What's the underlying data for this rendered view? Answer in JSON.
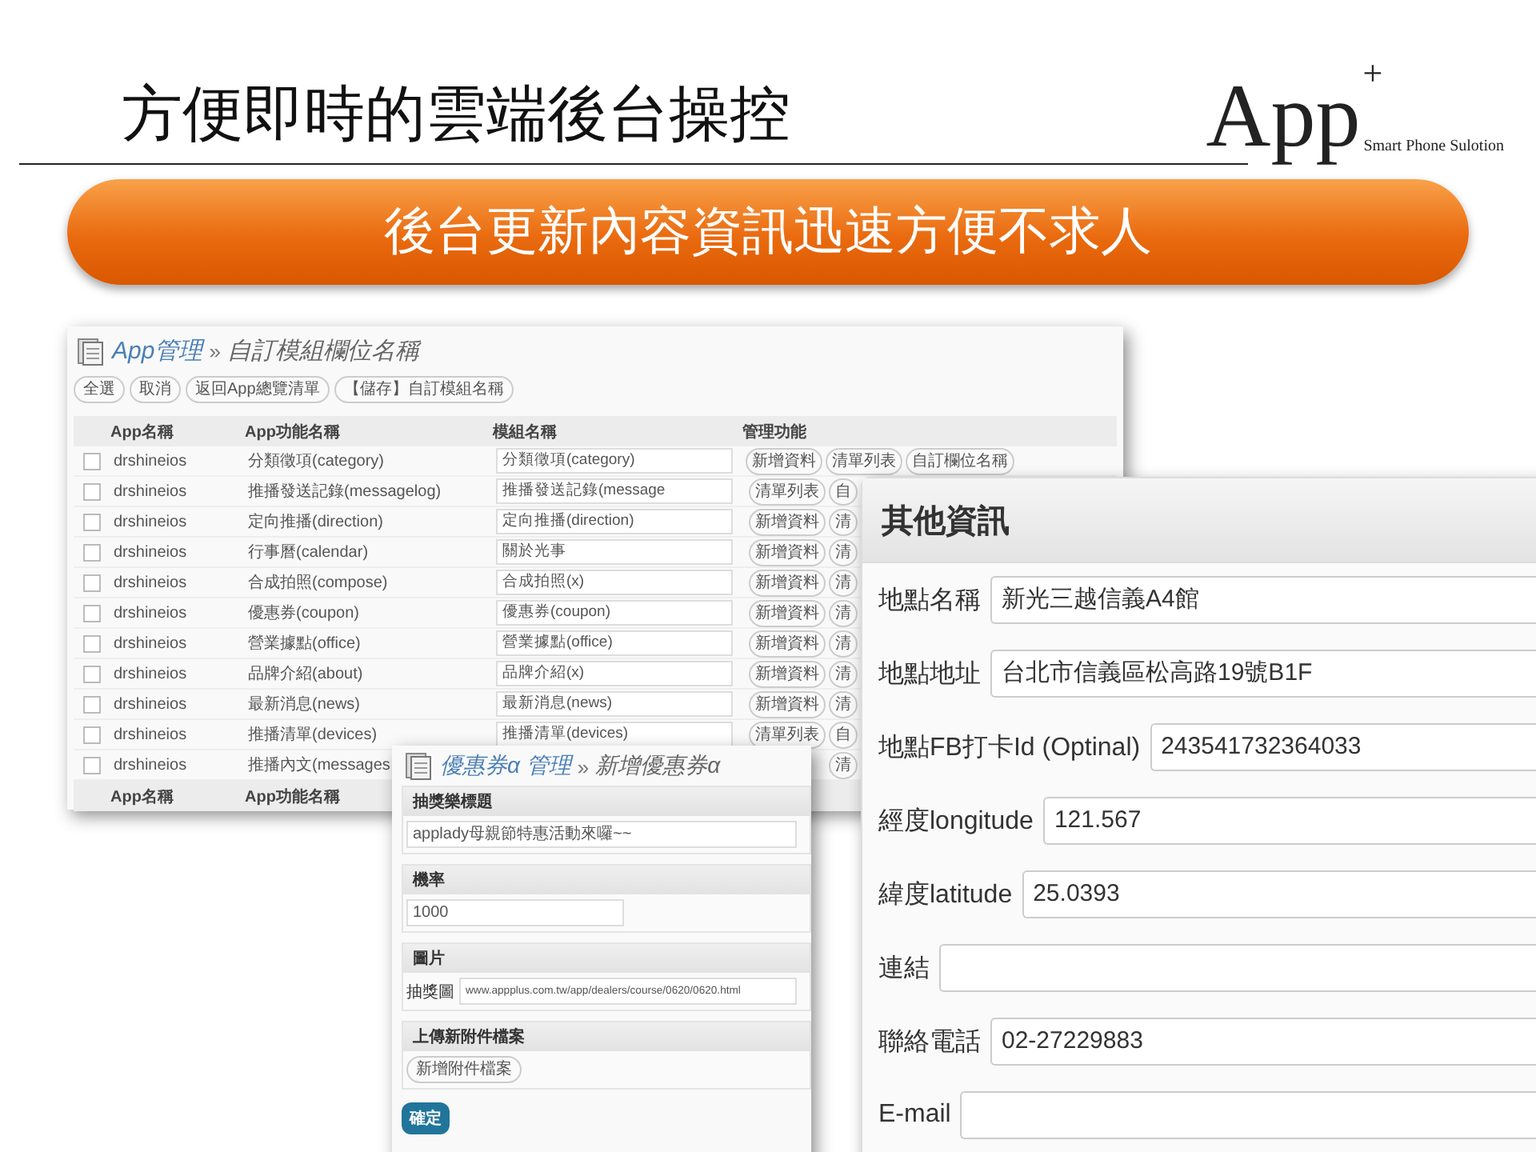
{
  "slide": {
    "title": "方便即時的雲端後台操控",
    "logo": {
      "name": "App",
      "superscript": "+",
      "tagline": "Smart Phone Sulotion"
    },
    "banner": "後台更新內容資訊迅速方便不求人"
  },
  "module_window": {
    "breadcrumb_link": "App管理",
    "breadcrumb_separator": "»",
    "breadcrumb_current": "自訂模組欄位名稱",
    "buttons": [
      "全選",
      "取消",
      "返回App總覽清單",
      "【儲存】自訂模組名稱"
    ],
    "columns": [
      "App名稱",
      "App功能名稱",
      "模組名稱",
      "管理功能"
    ],
    "rows": [
      {
        "checked": false,
        "app": "drshineios",
        "feature": "分類徵項(category)",
        "module": "分類徵項(category)",
        "actions": [
          "新增資料",
          "清單列表",
          "自訂欄位名稱"
        ]
      },
      {
        "checked": false,
        "app": "drshineios",
        "feature": "推播發送記錄(messagelog)",
        "module": "推播發送記錄(message",
        "actions": [
          "清單列表",
          "自"
        ]
      },
      {
        "checked": false,
        "app": "drshineios",
        "feature": "定向推播(direction)",
        "module": "定向推播(direction)",
        "actions": [
          "新增資料",
          "清"
        ]
      },
      {
        "checked": false,
        "app": "drshineios",
        "feature": "行事曆(calendar)",
        "module": "關於光事",
        "actions": [
          "新增資料",
          "清"
        ]
      },
      {
        "checked": false,
        "app": "drshineios",
        "feature": "合成拍照(compose)",
        "module": "合成拍照(x)",
        "actions": [
          "新增資料",
          "清"
        ]
      },
      {
        "checked": false,
        "app": "drshineios",
        "feature": "優惠券(coupon)",
        "module": "優惠券(coupon)",
        "actions": [
          "新增資料",
          "清"
        ]
      },
      {
        "checked": false,
        "app": "drshineios",
        "feature": "營業據點(office)",
        "module": "營業據點(office)",
        "actions": [
          "新增資料",
          "清"
        ]
      },
      {
        "checked": false,
        "app": "drshineios",
        "feature": "品牌介紹(about)",
        "module": "品牌介紹(x)",
        "actions": [
          "新增資料",
          "清"
        ]
      },
      {
        "checked": false,
        "app": "drshineios",
        "feature": "最新消息(news)",
        "module": "最新消息(news)",
        "actions": [
          "新增資料",
          "清"
        ]
      },
      {
        "checked": false,
        "app": "drshineios",
        "feature": "推播清單(devices)",
        "module": "推播清單(devices)",
        "actions": [
          "清單列表",
          "自"
        ]
      },
      {
        "checked": false,
        "app": "drshineios",
        "feature": "推播內文(messages",
        "actions": [
          "清"
        ]
      }
    ],
    "footer": [
      "App名稱",
      "App功能名稱"
    ]
  },
  "coupon_window": {
    "breadcrumb_link": "優惠券α 管理",
    "breadcrumb_separator": "»",
    "breadcrumb_current": "新增優惠券α",
    "sections": [
      {
        "kind": "text",
        "heading": "抽獎樂標題",
        "value": "applady母親節特惠活動來囉~~"
      },
      {
        "kind": "short",
        "heading": "機率",
        "value": "1000"
      },
      {
        "kind": "labeled",
        "heading": "圖片",
        "label": "抽獎圖",
        "value": "www.appplus.com.tw/app/dealers/course/0620/0620.html"
      },
      {
        "kind": "button",
        "heading": "上傳新附件檔案",
        "button": "新增附件檔案"
      }
    ],
    "submit": "確定"
  },
  "info_window": {
    "title": "其他資訊",
    "fields": [
      {
        "label": "地點名稱",
        "value": "新光三越信義A4館"
      },
      {
        "label": "地點地址",
        "value": "台北市信義區松高路19號B1F"
      },
      {
        "label": "地點FB打卡Id (Optinal)",
        "value": "243541732364033"
      },
      {
        "label": "經度longitude",
        "value": "121.567"
      },
      {
        "label": "緯度latitude",
        "value": "25.0393"
      },
      {
        "label": "連結"
      },
      {
        "label": "聯絡電話",
        "value": "02-27229883"
      },
      {
        "label": "E-mail"
      }
    ]
  }
}
